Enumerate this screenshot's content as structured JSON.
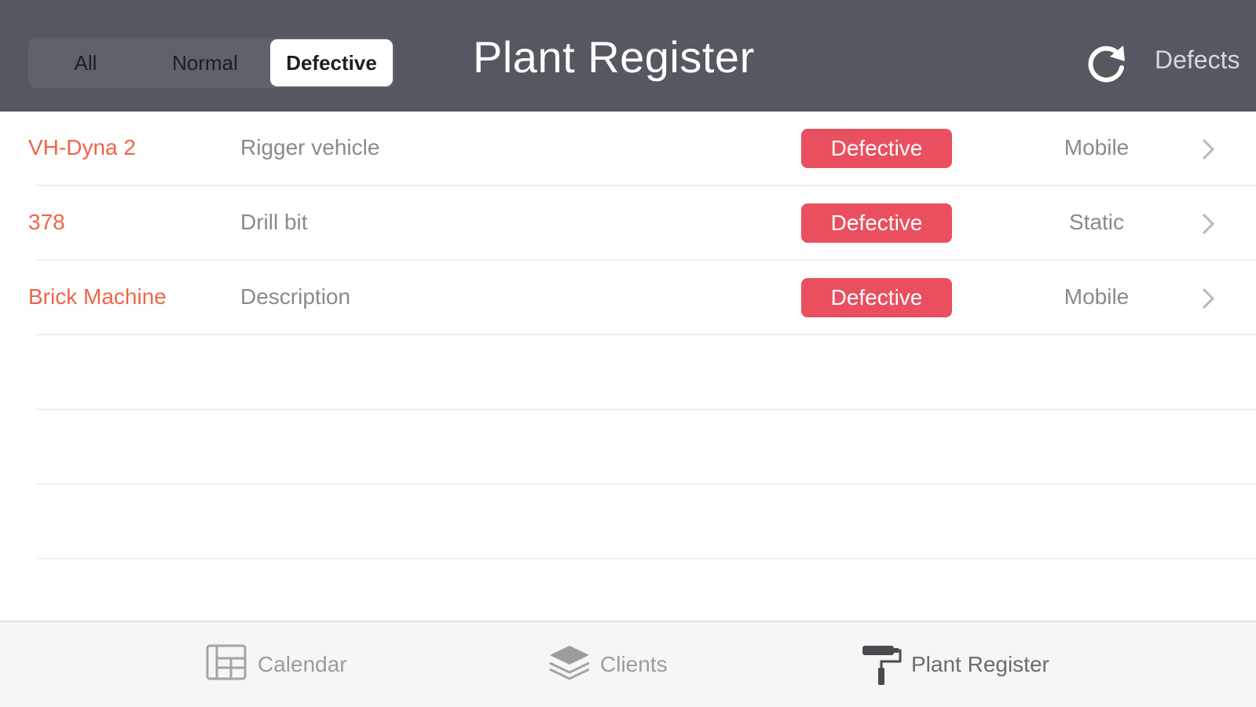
{
  "header": {
    "title": "Plant Register",
    "filters": {
      "all": "All",
      "normal": "Normal",
      "defective": "Defective",
      "selected": "Defective"
    },
    "refresh_icon": "refresh-icon",
    "defects_link": "Defects"
  },
  "rows": [
    {
      "id": "VH-Dyna 2",
      "description": "Rigger vehicle",
      "status": "Defective",
      "type": "Mobile"
    },
    {
      "id": "378",
      "description": "Drill bit",
      "status": "Defective",
      "type": "Static"
    },
    {
      "id": "Brick Machine",
      "description": "Description",
      "status": "Defective",
      "type": "Mobile"
    }
  ],
  "tabbar": {
    "calendar": "Calendar",
    "clients": "Clients",
    "plant_register": "Plant Register",
    "active": "Plant Register"
  },
  "colors": {
    "header_bg": "#555860",
    "id_text": "#f06449",
    "badge_bg": "#ea4f5f",
    "tabbar_bg": "#f6f6f7"
  }
}
